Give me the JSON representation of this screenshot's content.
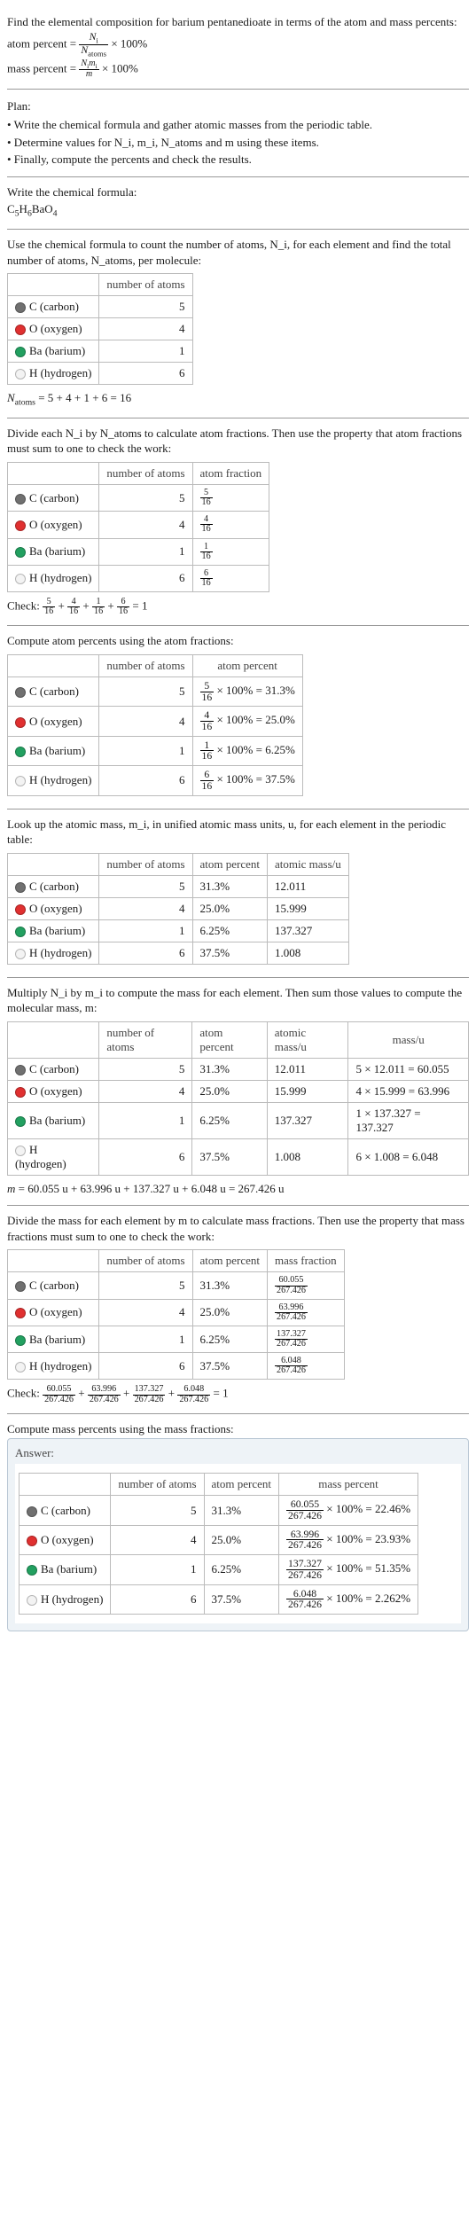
{
  "intro": {
    "line1": "Find the elemental composition for barium pentanedioate in terms of the atom and mass percents:",
    "atom_percent_label": "atom percent",
    "mass_percent_label": "mass percent",
    "frac1_num": "N_i",
    "frac1_den": "N_atoms",
    "frac2_num": "N_i m_i",
    "frac2_den": "m",
    "times100": " × 100%"
  },
  "plan": {
    "title": "Plan:",
    "b1": "• Write the chemical formula and gather atomic masses from the periodic table.",
    "b2": "• Determine values for N_i, m_i, N_atoms and m using these items.",
    "b3": "• Finally, compute the percents and check the results."
  },
  "formula": {
    "title": "Write the chemical formula:",
    "value": "C5H6BaO4"
  },
  "colors": {
    "C": "#707070",
    "O": "#e03030",
    "Ba": "#22a060",
    "H": "#f3f3f3"
  },
  "count": {
    "intro": "Use the chemical formula to count the number of atoms, N_i, for each element and find the total number of atoms, N_atoms, per molecule:",
    "hdr_atoms": "number of atoms",
    "rows": [
      {
        "name": "C (carbon)",
        "n": "5"
      },
      {
        "name": "O (oxygen)",
        "n": "4"
      },
      {
        "name": "Ba (barium)",
        "n": "1"
      },
      {
        "name": "H (hydrogen)",
        "n": "6"
      }
    ],
    "totalline": "N_atoms = 5 + 4 + 1 + 6 = 16"
  },
  "atomfrac": {
    "intro": "Divide each N_i by N_atoms to calculate atom fractions. Then use the property that atom fractions must sum to one to check the work:",
    "hdr_atoms": "number of atoms",
    "hdr_frac": "atom fraction",
    "rows": [
      {
        "name": "C (carbon)",
        "n": "5",
        "num": "5",
        "den": "16"
      },
      {
        "name": "O (oxygen)",
        "n": "4",
        "num": "4",
        "den": "16"
      },
      {
        "name": "Ba (barium)",
        "n": "1",
        "num": "1",
        "den": "16"
      },
      {
        "name": "H (hydrogen)",
        "n": "6",
        "num": "6",
        "den": "16"
      }
    ],
    "check_label": "Check: ",
    "check_sum": " = 1"
  },
  "atompct": {
    "intro": "Compute atom percents using the atom fractions:",
    "hdr_atoms": "number of atoms",
    "hdr_pct": "atom percent",
    "rows": [
      {
        "name": "C (carbon)",
        "n": "5",
        "num": "5",
        "den": "16",
        "mid": " × 100% = ",
        "pct": "31.3%"
      },
      {
        "name": "O (oxygen)",
        "n": "4",
        "num": "4",
        "den": "16",
        "mid": " × 100% = ",
        "pct": "25.0%"
      },
      {
        "name": "Ba (barium)",
        "n": "1",
        "num": "1",
        "den": "16",
        "mid": " × 100% = ",
        "pct": "6.25%"
      },
      {
        "name": "H (hydrogen)",
        "n": "6",
        "num": "6",
        "den": "16",
        "mid": " × 100% = ",
        "pct": "37.5%"
      }
    ]
  },
  "atommass": {
    "intro": "Look up the atomic mass, m_i, in unified atomic mass units, u, for each element in the periodic table:",
    "hdr_atoms": "number of atoms",
    "hdr_pct": "atom percent",
    "hdr_mass": "atomic mass/u",
    "rows": [
      {
        "name": "C (carbon)",
        "n": "5",
        "pct": "31.3%",
        "mass": "12.011"
      },
      {
        "name": "O (oxygen)",
        "n": "4",
        "pct": "25.0%",
        "mass": "15.999"
      },
      {
        "name": "Ba (barium)",
        "n": "1",
        "pct": "6.25%",
        "mass": "137.327"
      },
      {
        "name": "H (hydrogen)",
        "n": "6",
        "pct": "37.5%",
        "mass": "1.008"
      }
    ]
  },
  "massu": {
    "intro": "Multiply N_i by m_i to compute the mass for each element. Then sum those values to compute the molecular mass, m:",
    "hdr_atoms": "number of atoms",
    "hdr_pct": "atom percent",
    "hdr_mass": "atomic mass/u",
    "hdr_massu": "mass/u",
    "rows": [
      {
        "name": "C (carbon)",
        "n": "5",
        "pct": "31.3%",
        "mass": "12.011",
        "calc": "5 × 12.011 = 60.055"
      },
      {
        "name": "O (oxygen)",
        "n": "4",
        "pct": "25.0%",
        "mass": "15.999",
        "calc": "4 × 15.999 = 63.996"
      },
      {
        "name": "Ba (barium)",
        "n": "1",
        "pct": "6.25%",
        "mass": "137.327",
        "calc": "1 × 137.327 = 137.327"
      },
      {
        "name": "H (hydrogen)",
        "n": "6",
        "pct": "37.5%",
        "mass": "1.008",
        "calc": "6 × 1.008 = 6.048"
      }
    ],
    "totalline": "m = 60.055 u + 63.996 u + 137.327 u + 6.048 u = 267.426 u"
  },
  "massfrac": {
    "intro": "Divide the mass for each element by m to calculate mass fractions. Then use the property that mass fractions must sum to one to check the work:",
    "hdr_atoms": "number of atoms",
    "hdr_pct": "atom percent",
    "hdr_mf": "mass fraction",
    "rows": [
      {
        "name": "C (carbon)",
        "n": "5",
        "pct": "31.3%",
        "num": "60.055",
        "den": "267.426"
      },
      {
        "name": "O (oxygen)",
        "n": "4",
        "pct": "25.0%",
        "num": "63.996",
        "den": "267.426"
      },
      {
        "name": "Ba (barium)",
        "n": "1",
        "pct": "6.25%",
        "num": "137.327",
        "den": "267.426"
      },
      {
        "name": "H (hydrogen)",
        "n": "6",
        "pct": "37.5%",
        "num": "6.048",
        "den": "267.426"
      }
    ],
    "check_label": "Check: ",
    "check_sum": " = 1"
  },
  "masspct": {
    "intro": "Compute mass percents using the mass fractions:",
    "answer_label": "Answer:",
    "hdr_atoms": "number of atoms",
    "hdr_pct": "atom percent",
    "hdr_mp": "mass percent",
    "rows": [
      {
        "name": "C (carbon)",
        "n": "5",
        "pct": "31.3%",
        "num": "60.055",
        "den": "267.426",
        "mid": " × 100% = ",
        "mp": "22.46%"
      },
      {
        "name": "O (oxygen)",
        "n": "4",
        "pct": "25.0%",
        "num": "63.996",
        "den": "267.426",
        "mid": " × 100% = ",
        "mp": "23.93%"
      },
      {
        "name": "Ba (barium)",
        "n": "1",
        "pct": "6.25%",
        "num": "137.327",
        "den": "267.426",
        "mid": " × 100% = ",
        "mp": "51.35%"
      },
      {
        "name": "H (hydrogen)",
        "n": "6",
        "pct": "37.5%",
        "num": "6.048",
        "den": "267.426",
        "mid": " × 100% = ",
        "mp": "2.262%"
      }
    ]
  },
  "chart_data": {
    "type": "table",
    "title": "Elemental composition of barium pentanedioate (C5H6BaO4)",
    "columns": [
      "element",
      "number_of_atoms",
      "atom_percent",
      "atomic_mass_u",
      "mass_u",
      "mass_percent"
    ],
    "rows": [
      {
        "element": "C (carbon)",
        "number_of_atoms": 5,
        "atom_percent": 31.3,
        "atomic_mass_u": 12.011,
        "mass_u": 60.055,
        "mass_percent": 22.46
      },
      {
        "element": "O (oxygen)",
        "number_of_atoms": 4,
        "atom_percent": 25.0,
        "atomic_mass_u": 15.999,
        "mass_u": 63.996,
        "mass_percent": 23.93
      },
      {
        "element": "Ba (barium)",
        "number_of_atoms": 1,
        "atom_percent": 6.25,
        "atomic_mass_u": 137.327,
        "mass_u": 137.327,
        "mass_percent": 51.35
      },
      {
        "element": "H (hydrogen)",
        "number_of_atoms": 6,
        "atom_percent": 37.5,
        "atomic_mass_u": 1.008,
        "mass_u": 6.048,
        "mass_percent": 2.262
      }
    ],
    "totals": {
      "N_atoms": 16,
      "m_u": 267.426
    }
  }
}
